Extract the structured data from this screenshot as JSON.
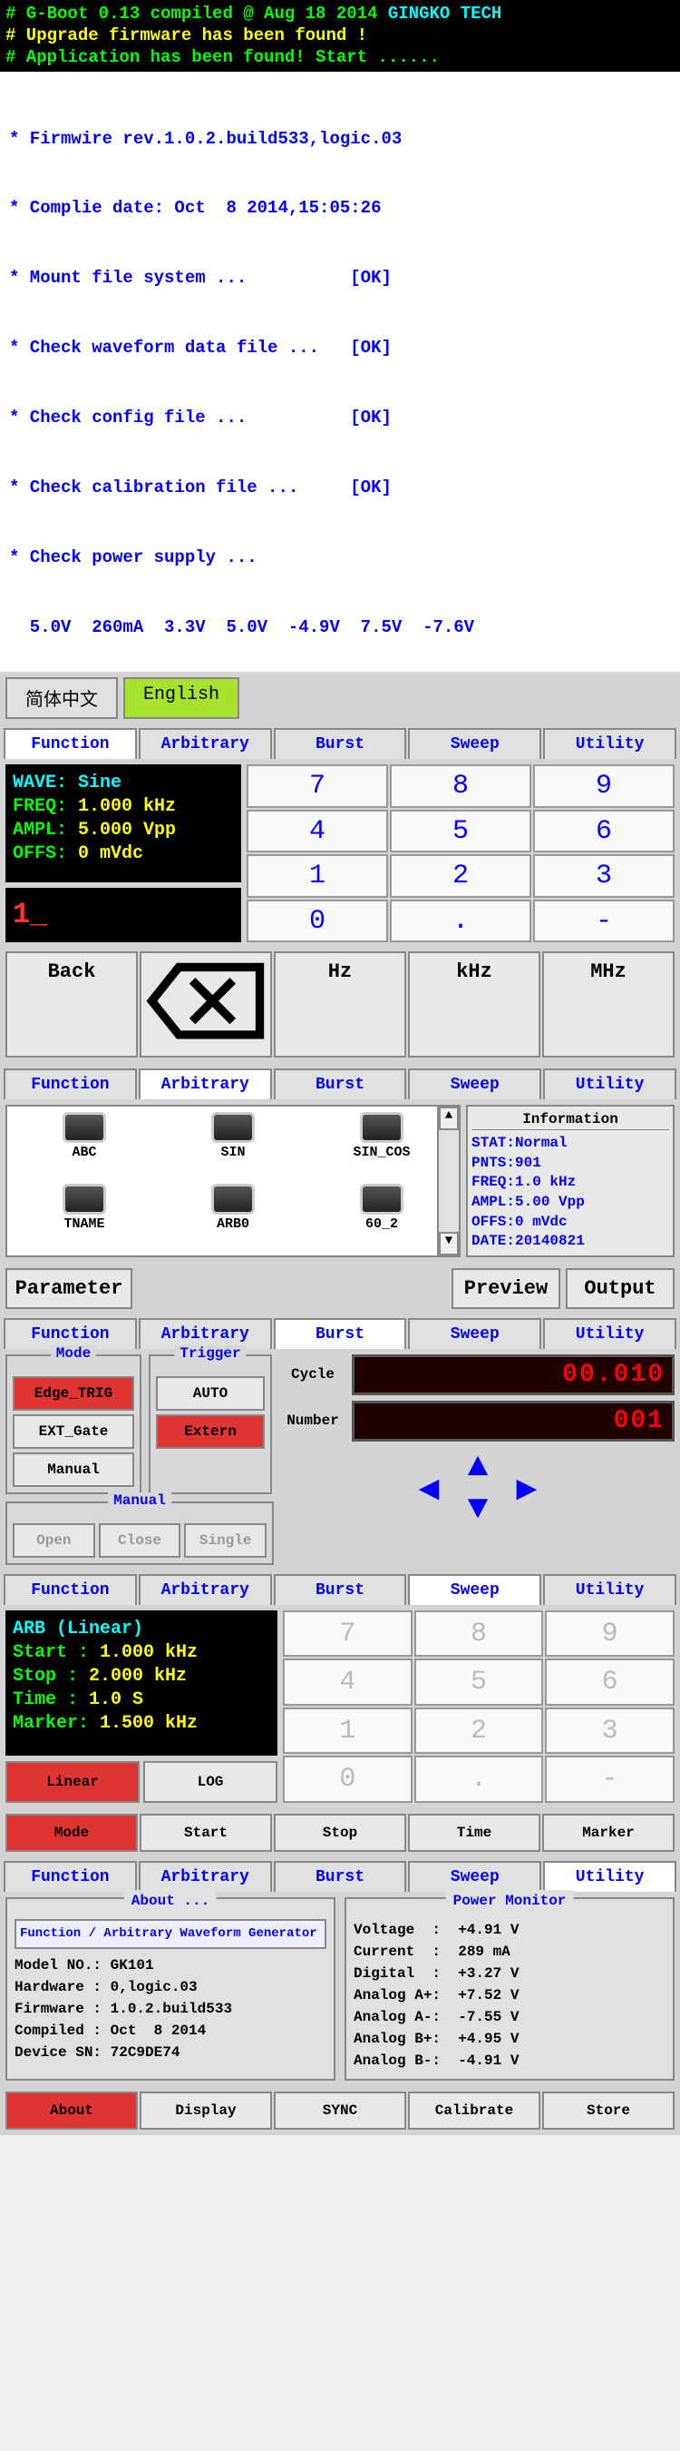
{
  "boot": {
    "line1a": "# G-Boot 0.13 compiled @ Aug 18 2014 ",
    "line1b": "GINGKO TECH",
    "line2": "# Upgrade firmware has been found !",
    "line3": "# Application has been found! Start ......"
  },
  "fw": {
    "l1": "* Firmwire rev.1.0.2.build533,logic.03",
    "l2": "* Complie date: Oct  8 2014,15:05:26",
    "l3": "* Mount file system ...          [OK]",
    "l4": "* Check waveform data file ...   [OK]",
    "l5": "* Check config file ...          [OK]",
    "l6": "* Check calibration file ...     [OK]",
    "l7": "* Check power supply ...",
    "l8": "  5.0V  260mA  3.3V  5.0V  -4.9V  7.5V  -7.6V"
  },
  "lang": {
    "chinese": "简体中文",
    "english": "English"
  },
  "tabs": {
    "function": "Function",
    "arbitrary": "Arbitrary",
    "burst": "Burst",
    "sweep": "Sweep",
    "utility": "Utility"
  },
  "func": {
    "wave_l": "WAVE:",
    "wave_v": "Sine",
    "freq_l": "FREQ:",
    "freq_v": "1.000 kHz",
    "ampl_l": "AMPL:",
    "ampl_v": "5.000 Vpp",
    "offs_l": "OFFS:",
    "offs_v": "0 mVdc",
    "entry": "1_"
  },
  "keys": {
    "k7": "7",
    "k8": "8",
    "k9": "9",
    "k4": "4",
    "k5": "5",
    "k6": "6",
    "k1": "1",
    "k2": "2",
    "k3": "3",
    "k0": "0",
    "kdot": ".",
    "kminus": "-"
  },
  "units": {
    "back": "Back",
    "del": "⌫",
    "hz": "Hz",
    "khz": "kHz",
    "mhz": "MHz"
  },
  "arb": {
    "items": [
      "ABC",
      "SIN",
      "SIN_COS",
      "TNAME",
      "ARB0",
      "60_2"
    ],
    "info_title": "Information",
    "stat": "STAT:Normal",
    "pnts": "PNTS:901",
    "freq": "FREQ:1.0  kHz",
    "ampl": "AMPL:5.00 Vpp",
    "offs": "OFFS:0 mVdc",
    "date": "DATE:20140821",
    "param": "Parameter",
    "preview": "Preview",
    "output": "Output"
  },
  "burst": {
    "mode_title": "Mode",
    "trigger_title": "Trigger",
    "manual_title": "Manual",
    "edge": "Edge_TRIG",
    "ext": "EXT_Gate",
    "manual": "Manual",
    "auto": "AUTO",
    "extern": "Extern",
    "open": "Open",
    "close": "Close",
    "single": "Single",
    "cycle_l": "Cycle",
    "cycle_v": "00.010",
    "number_l": "Number",
    "number_v": "001"
  },
  "sweep": {
    "l1": "ARB (Linear)",
    "l2a": "Start :",
    "l2b": "1.000 kHz",
    "l3a": "Stop  :",
    "l3b": "2.000 kHz",
    "l4a": "Time  :",
    "l4b": "1.0 S",
    "l5a": "Marker:",
    "l5b": "1.500 kHz",
    "linear": "Linear",
    "log": "LOG",
    "bb": {
      "mode": "Mode",
      "start": "Start",
      "stop": "Stop",
      "time": "Time",
      "marker": "Marker"
    }
  },
  "util": {
    "about_title": "About ...",
    "pm_title": "Power Monitor",
    "desc": "Function / Arbitrary Waveform Generator",
    "m1": "Model NO.: GK101",
    "m2": "Hardware : 0,logic.03",
    "m3": "Firmware : 1.0.2.build533",
    "m4": "Compiled : Oct  8 2014",
    "m5": "Device SN: 72C9DE74",
    "p1": "Voltage  :  +4.91 V",
    "p2": "Current  :  289 mA",
    "p3": "Digital  :  +3.27 V",
    "p4": "Analog A+:  +7.52 V",
    "p5": "Analog A-:  -7.55 V",
    "p6": "Analog B+:  +4.95 V",
    "p7": "Analog B-:  -4.91 V",
    "bb": {
      "about": "About",
      "display": "Display",
      "sync": "SYNC",
      "calibrate": "Calibrate",
      "store": "Store"
    }
  }
}
